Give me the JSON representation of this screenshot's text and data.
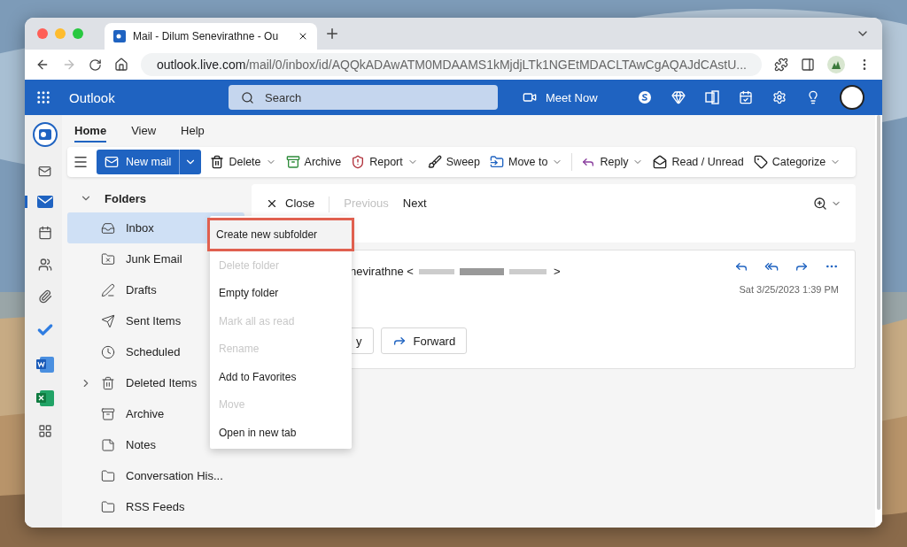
{
  "browser": {
    "tab_title": "Mail - Dilum Senevirathne - Ou",
    "url_host": "outlook.live.com",
    "url_path": "/mail/0/inbox/id/AQQkADAwATM0MDAAMS1kMjdjLTk1NGEtMDACLTAwCgAQAJdCAstU..."
  },
  "app": {
    "name": "Outlook",
    "search_placeholder": "Search",
    "meet_now": "Meet Now"
  },
  "rail": [
    {
      "kind": "outlook",
      "selected": false
    },
    {
      "kind": "mail-small",
      "selected": false
    },
    {
      "kind": "mail",
      "selected": true
    },
    {
      "kind": "calendar",
      "selected": false
    },
    {
      "kind": "people",
      "selected": false
    },
    {
      "kind": "attach",
      "selected": false
    },
    {
      "kind": "todo",
      "selected": false
    },
    {
      "kind": "word",
      "selected": false
    },
    {
      "kind": "excel",
      "selected": false
    },
    {
      "kind": "apps",
      "selected": false
    }
  ],
  "ribbon_tabs": [
    {
      "label": "Home",
      "selected": true
    },
    {
      "label": "View",
      "selected": false
    },
    {
      "label": "Help",
      "selected": false
    }
  ],
  "new_mail": "New mail",
  "toolbar": [
    {
      "kind": "delete",
      "label": "Delete",
      "dropdown": true
    },
    {
      "kind": "archive",
      "label": "Archive",
      "dropdown": false
    },
    {
      "kind": "report",
      "label": "Report",
      "dropdown": true
    },
    {
      "kind": "sweep",
      "label": "Sweep",
      "dropdown": false
    },
    {
      "kind": "move",
      "label": "Move to",
      "dropdown": true
    },
    {
      "kind": "reply",
      "label": "Reply",
      "dropdown": true
    },
    {
      "kind": "read",
      "label": "Read / Unread",
      "dropdown": false
    },
    {
      "kind": "categorize",
      "label": "Categorize",
      "dropdown": true
    }
  ],
  "folders": {
    "title": "Folders",
    "expanded": true,
    "items": [
      {
        "kind": "inbox",
        "label": "Inbox",
        "selected": true,
        "collapsed_children": false
      },
      {
        "kind": "junk",
        "label": "Junk Email",
        "selected": false,
        "collapsed_children": false
      },
      {
        "kind": "drafts",
        "label": "Drafts",
        "selected": false,
        "collapsed_children": false
      },
      {
        "kind": "sent",
        "label": "Sent Items",
        "selected": false,
        "collapsed_children": false
      },
      {
        "kind": "scheduled",
        "label": "Scheduled",
        "selected": false,
        "collapsed_children": false
      },
      {
        "kind": "deleted",
        "label": "Deleted Items",
        "selected": false,
        "collapsed_children": true
      },
      {
        "kind": "archive",
        "label": "Archive",
        "selected": false,
        "collapsed_children": false
      },
      {
        "kind": "notes",
        "label": "Notes",
        "selected": false,
        "collapsed_children": false
      },
      {
        "kind": "folder",
        "label": "Conversation His...",
        "selected": false,
        "collapsed_children": false
      },
      {
        "kind": "folder",
        "label": "RSS Feeds",
        "selected": false,
        "collapsed_children": false
      }
    ]
  },
  "reading_pane": {
    "close": "Close",
    "previous": "Previous",
    "previous_disabled": true,
    "next": "Next",
    "sender_start": "nevirathne <",
    "sender_end": ">",
    "date": "Sat 3/25/2023 1:39 PM",
    "reply_fragment": "y",
    "forward": "Forward"
  },
  "context_menu": [
    {
      "label": "Create new subfolder",
      "disabled": false,
      "highlighted": true
    },
    {
      "label": "Delete folder",
      "disabled": true,
      "highlighted": false
    },
    {
      "label": "Empty folder",
      "disabled": false,
      "highlighted": false
    },
    {
      "label": "Mark all as read",
      "disabled": true,
      "highlighted": false
    },
    {
      "label": "Rename",
      "disabled": true,
      "highlighted": false
    },
    {
      "label": "Add to Favorites",
      "disabled": false,
      "highlighted": false
    },
    {
      "label": "Move",
      "disabled": true,
      "highlighted": false
    },
    {
      "label": "Open in new tab",
      "disabled": false,
      "highlighted": false
    }
  ]
}
